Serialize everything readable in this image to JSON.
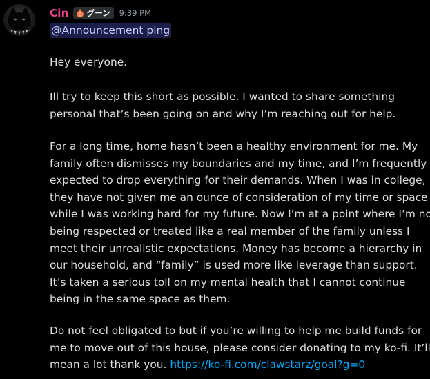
{
  "message": {
    "author": {
      "name": "Cin",
      "name_color": "#f0408c",
      "avatar_icon": "black-cat-avatar-icon",
      "tag": {
        "icon": "flame-heart-icon",
        "label": "グーン"
      }
    },
    "timestamp": "9:39 PM",
    "mention": "@Announcement ping",
    "body": {
      "greeting": "Hey everyone.",
      "intro": [
        "Ill try to keep this short as possible. I wanted to share something",
        "personal that’s been going on and why I’m reaching out for help."
      ],
      "story": [
        "For a long time, home hasn’t been a healthy environment for me. My",
        "family often dismisses my boundaries and my time, and I’m frequently",
        "expected to drop everything for their demands. When I was in college,",
        "they have not given me an ounce of consideration of my time or space",
        "while I was working hard for my future. Now I’m at a point where I’m not",
        "being respected or treated like a real member of the family unless I",
        "meet their unrealistic expectations. Money has become a hierarchy in",
        "our household, and “family” is used more like leverage than support.",
        "It’s taken a serious toll on my mental health that I cannot continue",
        "being in the same space as them."
      ],
      "ask": [
        "Do not feel obligated to but if you’re willing to help me build funds for",
        "me to move out of this house, please consider donating to my ko-fi. It’ll"
      ],
      "ask_last_prefix": "mean a lot thank you. ",
      "link": "https://ko-fi.com/clawstarz/goal?g=0"
    }
  },
  "colors": {
    "background": "#000000",
    "text": "#dbdee1",
    "muted": "#949ba4",
    "link": "#00a8fc",
    "mention_bg": "#3a3f7a"
  }
}
